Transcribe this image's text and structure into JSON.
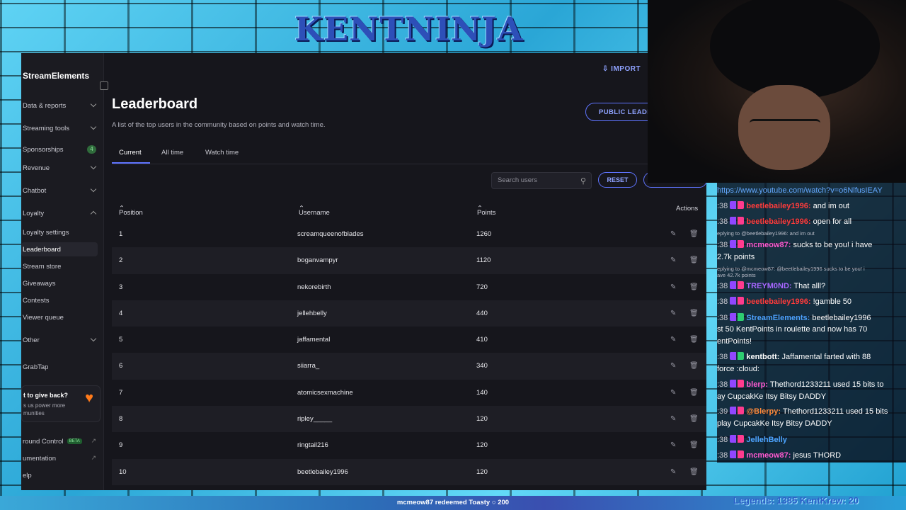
{
  "overlay": {
    "logo_text": "KENTNINJA",
    "bottom_redeem": "mcmeow87 redeemed Toasty ○ 200",
    "ticker_text": "Legends: 1385 KentKrew: 20"
  },
  "app": {
    "brand": "StreamElements",
    "sidebar": {
      "items": [
        {
          "label": "Data & reports"
        },
        {
          "label": "Streaming tools"
        },
        {
          "label": "Sponsorships",
          "badge": "4"
        },
        {
          "label": "Revenue"
        },
        {
          "label": "Chatbot"
        },
        {
          "label": "Loyalty"
        },
        {
          "label": "Loyalty settings"
        },
        {
          "label": "Leaderboard"
        },
        {
          "label": "Stream store"
        },
        {
          "label": "Giveaways"
        },
        {
          "label": "Contests"
        },
        {
          "label": "Viewer queue"
        },
        {
          "label": "Other"
        },
        {
          "label": "GrabTap"
        }
      ],
      "promo": {
        "title": "t to give back?",
        "body": "s us power more munities"
      },
      "footer": [
        {
          "label": "round Control",
          "badge": "BETA"
        },
        {
          "label": "umentation"
        },
        {
          "label": "elp"
        }
      ]
    },
    "topbar": {
      "import_label": "IMPORT"
    },
    "page": {
      "title": "Leaderboard",
      "description": "A list of the top users in the community based on points and watch time.",
      "public_button": "PUBLIC LEADERBOARD"
    },
    "tabs": [
      "Current",
      "All time",
      "Watch time"
    ],
    "search": {
      "placeholder": "Search users"
    },
    "reset_label": "RESET",
    "table": {
      "headers": {
        "position": "Position",
        "username": "Username",
        "points": "Points",
        "actions": "Actions"
      },
      "rows": [
        {
          "position": "1",
          "username": "screamqueenofblades",
          "points": "1260"
        },
        {
          "position": "2",
          "username": "boganvampyr",
          "points": "1120"
        },
        {
          "position": "3",
          "username": "nekorebirth",
          "points": "720"
        },
        {
          "position": "4",
          "username": "jellehbelly",
          "points": "440"
        },
        {
          "position": "5",
          "username": "jaffamental",
          "points": "410"
        },
        {
          "position": "6",
          "username": "siiarra_",
          "points": "340"
        },
        {
          "position": "7",
          "username": "atomicsexmachine",
          "points": "140"
        },
        {
          "position": "8",
          "username": "ripley_____",
          "points": "120"
        },
        {
          "position": "9",
          "username": "ringtail216",
          "points": "120"
        },
        {
          "position": "10",
          "username": "beetlebailey1996",
          "points": "120"
        }
      ]
    }
  },
  "chat": {
    "link": "https://www.youtube.com/watch?v=o6NlfusIEAY",
    "m1": {
      "ts": ":38",
      "user": "beetlebailey1996:",
      "text": " and im out"
    },
    "m2": {
      "ts": ":38",
      "user": "beetlebailey1996:",
      "text": " open for all"
    },
    "r2": "eplying to @beetlebailey1996: and im out",
    "m3": {
      "ts": ":38",
      "user": "mcmeow87:",
      "text": " sucks to be you! i have"
    },
    "m3b": "2.7k points",
    "r3": "eplying to @mcmeow87: @beetlebailey1996 sucks to be you! i",
    "r3b": "ave 42.7k points",
    "m4": {
      "ts": ":38",
      "user": "TREYM0ND:",
      "text": " That alll?"
    },
    "m5": {
      "ts": ":38",
      "user": "beetlebailey1996:",
      "text": " !gamble 50"
    },
    "m6": {
      "ts": ":38",
      "user": "StreamElements:",
      "text": " beetlebailey1996"
    },
    "m6b": "st 50 KentPoints in roulette and now has 70",
    "m6c": "entPoints!",
    "m7": {
      "ts": ":38",
      "user": "kentbott:",
      "text": " Jaffamental farted with 88"
    },
    "m7b": "force :cloud:",
    "m8": {
      "ts": ":38",
      "user": "blerp:",
      "text": " Thethord1233211 used 15 bits to"
    },
    "m8b": "ay CupcakKe Itsy Bitsy DADDY",
    "m9": {
      "ts": ":39",
      "user": "@Blerpy:",
      "text": " Thethord1233211 used 15 bits"
    },
    "m9b": "play CupcakKe Itsy Bitsy DADDY",
    "m10": {
      "ts": ":38",
      "user": "JellehBelly"
    },
    "m11": {
      "ts": ":38",
      "user": "mcmeow87:",
      "text": " jesus THORD"
    }
  }
}
